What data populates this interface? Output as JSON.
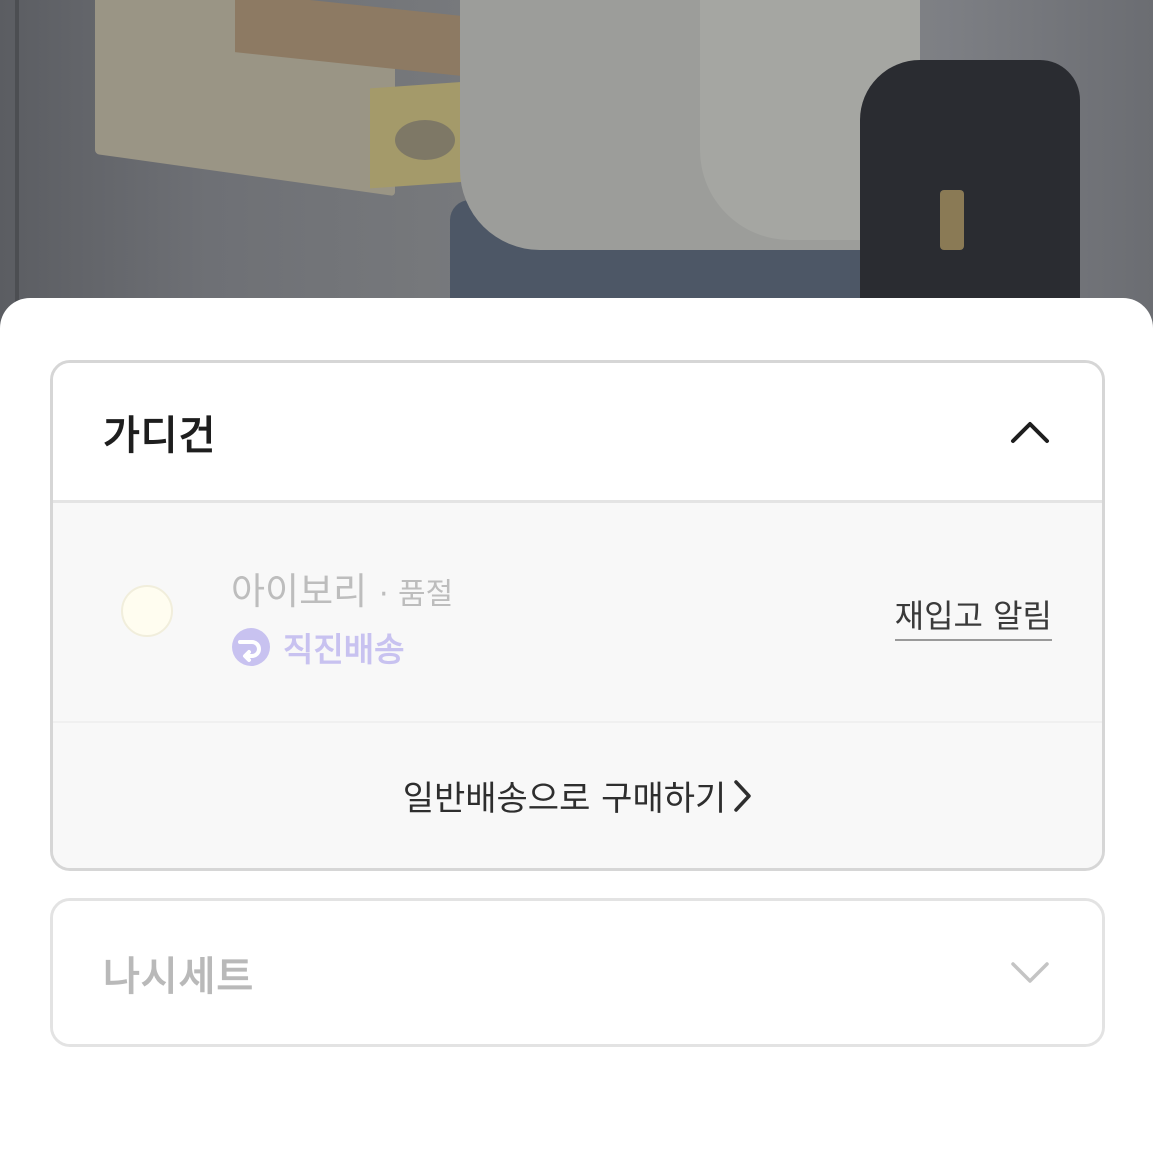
{
  "groups": [
    {
      "title": "가디건",
      "expanded": true,
      "options": [
        {
          "name": "아이보리",
          "status": "· 품절",
          "swatch_color": "#fffdf0",
          "delivery_label": "직진배송",
          "delivery_color": "#c8c2f0",
          "restock_label": "재입고 알림"
        }
      ],
      "alt_purchase_label": "일반배송으로 구매하기"
    },
    {
      "title": "나시세트",
      "expanded": false
    }
  ],
  "icons": {
    "collapse": "chevron-up-icon",
    "expand": "chevron-down-icon",
    "delivery": "direct-delivery-icon",
    "alt_purchase": "chevron-right-icon"
  }
}
